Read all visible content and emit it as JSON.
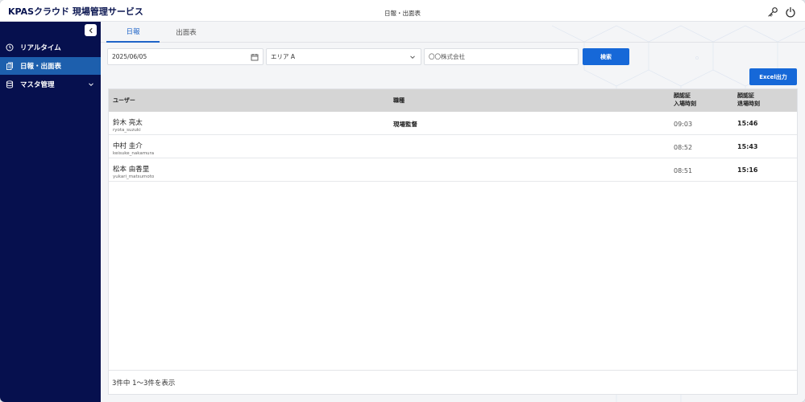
{
  "header": {
    "app_title": "KPASクラウド 現場管理サービス",
    "page_title": "日報・出面表",
    "icons": [
      "key-icon",
      "power-icon"
    ]
  },
  "sidebar": {
    "items": [
      {
        "label": "リアルタイム",
        "icon": "clock-icon",
        "active": false
      },
      {
        "label": "日報・出面表",
        "icon": "report-icon",
        "active": true
      },
      {
        "label": "マスタ管理",
        "icon": "database-icon",
        "active": false
      }
    ]
  },
  "tabs": [
    {
      "label": "日報",
      "active": true
    },
    {
      "label": "出面表",
      "active": false
    }
  ],
  "filters": {
    "date": "2025/06/05",
    "area": "エリア A",
    "company": "〇〇株式会社",
    "search_label": "検索",
    "export_label": "Excel出力"
  },
  "table": {
    "headers": {
      "user": "ユーザー",
      "job": "職種",
      "in_l1": "顔認証",
      "in_l2": "入場時刻",
      "out_l1": "顔認証",
      "out_l2": "退場時刻"
    },
    "rows": [
      {
        "name": "鈴木 亮太",
        "id": "ryota_suzuki",
        "job": "現場監督",
        "in": "09:03",
        "out": "15:46"
      },
      {
        "name": "中村 圭介",
        "id": "keisuke_nakamura",
        "job": "",
        "in": "08:52",
        "out": "15:43"
      },
      {
        "name": "松本 由香里",
        "id": "yukari_matsumoto",
        "job": "",
        "in": "08:51",
        "out": "15:16"
      }
    ],
    "footer": "3件中 1〜3件を表示"
  },
  "colors": {
    "sidebar_bg": "#06104e",
    "active_nav": "#1d5fad",
    "accent": "#1668d8",
    "title": "#0a1550"
  }
}
